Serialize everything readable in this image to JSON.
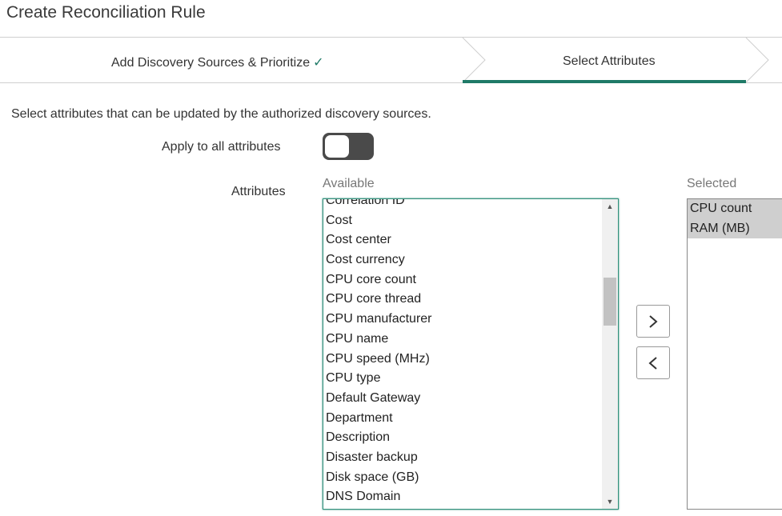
{
  "page": {
    "title": "Create Reconciliation Rule"
  },
  "wizard": {
    "steps": [
      {
        "label": "Add Discovery Sources & Prioritize",
        "completed": true
      },
      {
        "label": "Select Attributes",
        "active": true
      }
    ],
    "accent_color": "#1f7a67"
  },
  "description": "Select attributes that can be updated by the authorized discovery sources.",
  "apply_all": {
    "label": "Apply to all attributes",
    "checked": false
  },
  "attributes": {
    "label": "Attributes",
    "available_label": "Available",
    "selected_label": "Selected",
    "available": [
      "Correlation ID",
      "Cost",
      "Cost center",
      "Cost currency",
      "CPU core count",
      "CPU core thread",
      "CPU manufacturer",
      "CPU name",
      "CPU speed (MHz)",
      "CPU type",
      "Default Gateway",
      "Department",
      "Description",
      "Disaster backup",
      "Disk space (GB)",
      "DNS Domain"
    ],
    "selected": [
      "CPU count",
      "RAM (MB)"
    ]
  },
  "icons": {
    "check": "checkmark-icon",
    "add": "chevron-right-icon",
    "remove": "chevron-left-icon"
  }
}
